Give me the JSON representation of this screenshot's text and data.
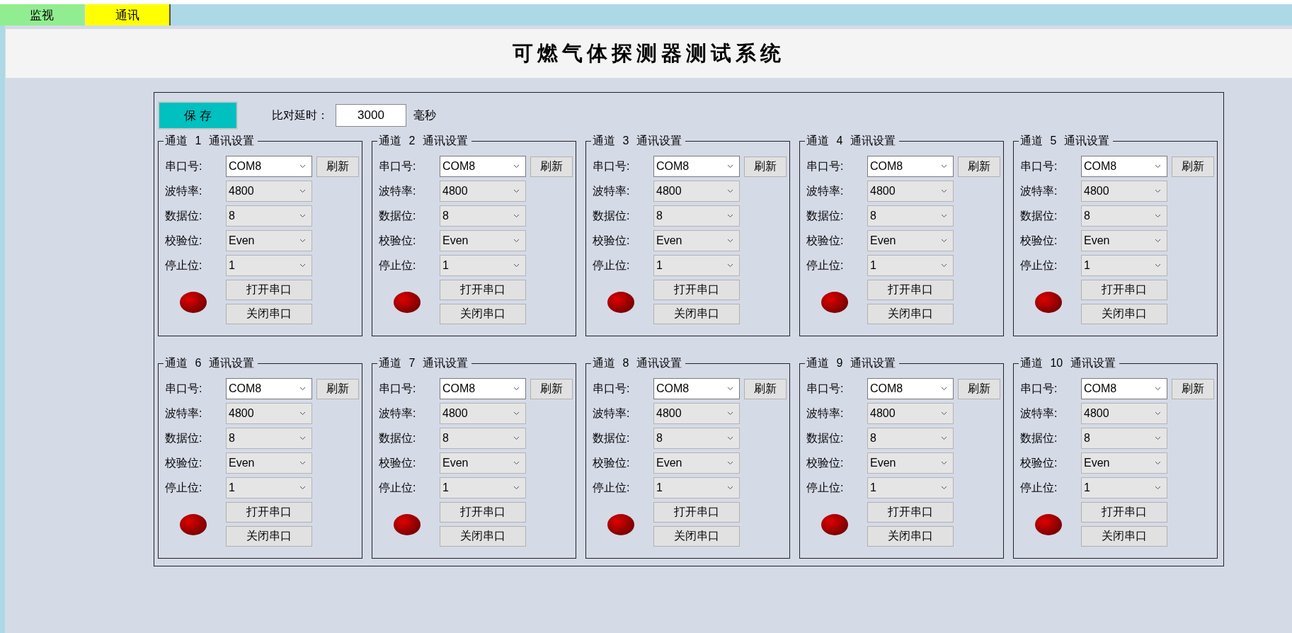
{
  "tabs": [
    {
      "label": "监视",
      "selected": false,
      "color": "#90ee90"
    },
    {
      "label": "通讯",
      "selected": true,
      "color": "#ffff00"
    }
  ],
  "title": "可燃气体探测器测试系统",
  "toolbar": {
    "save_button": "保 存",
    "delay_label": "比对延时：",
    "delay_value": "3000",
    "delay_unit": "毫秒"
  },
  "channels": [
    {
      "title": "通道 1 通讯设置",
      "port_label": "串口号:",
      "port": "COM8",
      "refresh": "刷新",
      "settings": [
        {
          "label": "波特率:",
          "value": "4800"
        },
        {
          "label": "数据位:",
          "value": "8"
        },
        {
          "label": "校验位:",
          "value": "Even"
        },
        {
          "label": "停止位:",
          "value": "1"
        }
      ],
      "open_button": "打开串口",
      "close_button": "关闭串口",
      "connected": false
    },
    {
      "title": "通道 2 通讯设置",
      "port_label": "串口号:",
      "port": "COM8",
      "refresh": "刷新",
      "settings": [
        {
          "label": "波特率:",
          "value": "4800"
        },
        {
          "label": "数据位:",
          "value": "8"
        },
        {
          "label": "校验位:",
          "value": "Even"
        },
        {
          "label": "停止位:",
          "value": "1"
        }
      ],
      "open_button": "打开串口",
      "close_button": "关闭串口",
      "connected": false
    },
    {
      "title": "通道 3 通讯设置",
      "port_label": "串口号:",
      "port": "COM8",
      "refresh": "刷新",
      "settings": [
        {
          "label": "波特率:",
          "value": "4800"
        },
        {
          "label": "数据位:",
          "value": "8"
        },
        {
          "label": "校验位:",
          "value": "Even"
        },
        {
          "label": "停止位:",
          "value": "1"
        }
      ],
      "open_button": "打开串口",
      "close_button": "关闭串口",
      "connected": false
    },
    {
      "title": "通道 4 通讯设置",
      "port_label": "串口号:",
      "port": "COM8",
      "refresh": "刷新",
      "settings": [
        {
          "label": "波特率:",
          "value": "4800"
        },
        {
          "label": "数据位:",
          "value": "8"
        },
        {
          "label": "校验位:",
          "value": "Even"
        },
        {
          "label": "停止位:",
          "value": "1"
        }
      ],
      "open_button": "打开串口",
      "close_button": "关闭串口",
      "connected": false
    },
    {
      "title": "通道 5 通讯设置",
      "port_label": "串口号:",
      "port": "COM8",
      "refresh": "刷新",
      "settings": [
        {
          "label": "波特率:",
          "value": "4800"
        },
        {
          "label": "数据位:",
          "value": "8"
        },
        {
          "label": "校验位:",
          "value": "Even"
        },
        {
          "label": "停止位:",
          "value": "1"
        }
      ],
      "open_button": "打开串口",
      "close_button": "关闭串口",
      "connected": false
    },
    {
      "title": "通道 6 通讯设置",
      "port_label": "串口号:",
      "port": "COM8",
      "refresh": "刷新",
      "settings": [
        {
          "label": "波特率:",
          "value": "4800"
        },
        {
          "label": "数据位:",
          "value": "8"
        },
        {
          "label": "校验位:",
          "value": "Even"
        },
        {
          "label": "停止位:",
          "value": "1"
        }
      ],
      "open_button": "打开串口",
      "close_button": "关闭串口",
      "connected": false
    },
    {
      "title": "通道 7 通讯设置",
      "port_label": "串口号:",
      "port": "COM8",
      "refresh": "刷新",
      "settings": [
        {
          "label": "波特率:",
          "value": "4800"
        },
        {
          "label": "数据位:",
          "value": "8"
        },
        {
          "label": "校验位:",
          "value": "Even"
        },
        {
          "label": "停止位:",
          "value": "1"
        }
      ],
      "open_button": "打开串口",
      "close_button": "关闭串口",
      "connected": false
    },
    {
      "title": "通道 8 通讯设置",
      "port_label": "串口号:",
      "port": "COM8",
      "refresh": "刷新",
      "settings": [
        {
          "label": "波特率:",
          "value": "4800"
        },
        {
          "label": "数据位:",
          "value": "8"
        },
        {
          "label": "校验位:",
          "value": "Even"
        },
        {
          "label": "停止位:",
          "value": "1"
        }
      ],
      "open_button": "打开串口",
      "close_button": "关闭串口",
      "connected": false
    },
    {
      "title": "通道 9 通讯设置",
      "port_label": "串口号:",
      "port": "COM8",
      "refresh": "刷新",
      "settings": [
        {
          "label": "波特率:",
          "value": "4800"
        },
        {
          "label": "数据位:",
          "value": "8"
        },
        {
          "label": "校验位:",
          "value": "Even"
        },
        {
          "label": "停止位:",
          "value": "1"
        }
      ],
      "open_button": "打开串口",
      "close_button": "关闭串口",
      "connected": false
    },
    {
      "title": "通道 10 通讯设置",
      "port_label": "串口号:",
      "port": "COM8",
      "refresh": "刷新",
      "settings": [
        {
          "label": "波特率:",
          "value": "4800"
        },
        {
          "label": "数据位:",
          "value": "8"
        },
        {
          "label": "校验位:",
          "value": "Even"
        },
        {
          "label": "停止位:",
          "value": "1"
        }
      ],
      "open_button": "打开串口",
      "close_button": "关闭串口",
      "connected": false
    }
  ]
}
